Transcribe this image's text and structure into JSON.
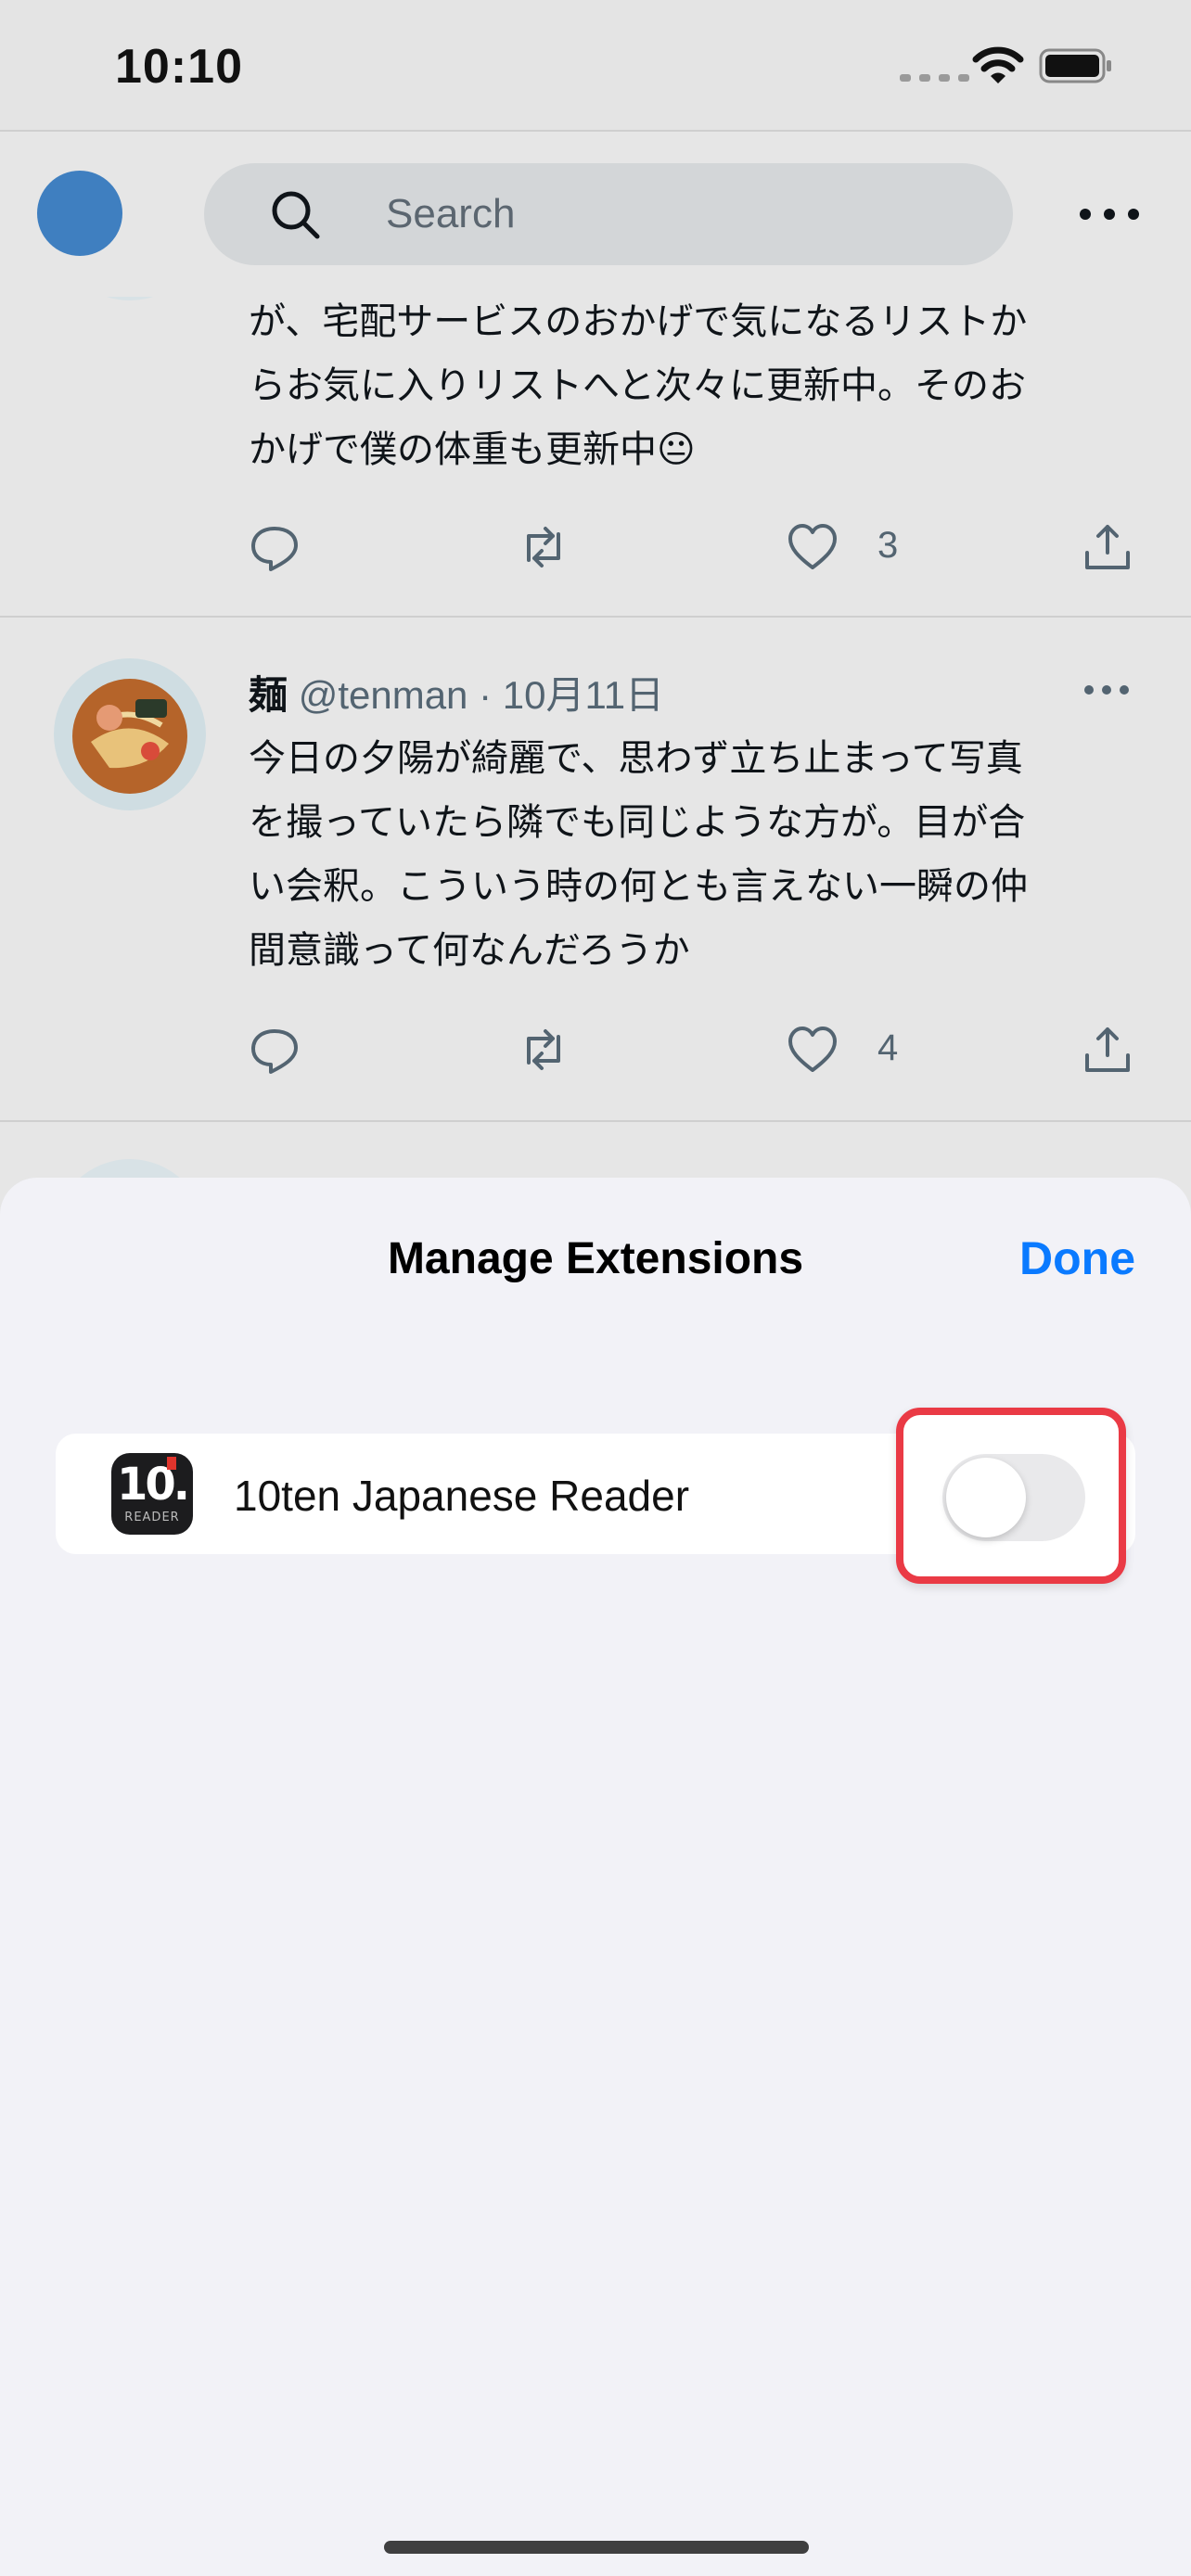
{
  "status": {
    "time": "10:10"
  },
  "header": {
    "search_placeholder": "Search"
  },
  "tweets": [
    {
      "text_lines": [
        "が、宅配サービスのおかげで気になるリストか",
        "らお気に入りリストへと次々に更新中。そのお",
        "かげで僕の体重も更新中😐"
      ],
      "likes": "3"
    },
    {
      "name": "麺",
      "handle": "@tenman · 10月11日",
      "text_lines": [
        "今日の夕陽が綺麗で、思わず立ち止まって写真",
        "を撮っていたら隣でも同じような方が。目が合",
        "い会釈。こういう時の何とも言えない一瞬の仲",
        "間意識って何なんだろうか"
      ],
      "likes": "4"
    }
  ],
  "sheet": {
    "title": "Manage Extensions",
    "done_label": "Done",
    "extensions": [
      {
        "name": "10ten Japanese Reader",
        "icon_big": "10.",
        "icon_small": "READER",
        "enabled": false
      }
    ]
  },
  "colors": {
    "accent": "#0a7aff",
    "highlight": "#ea3a45",
    "avatar": "#3f7fc0"
  }
}
